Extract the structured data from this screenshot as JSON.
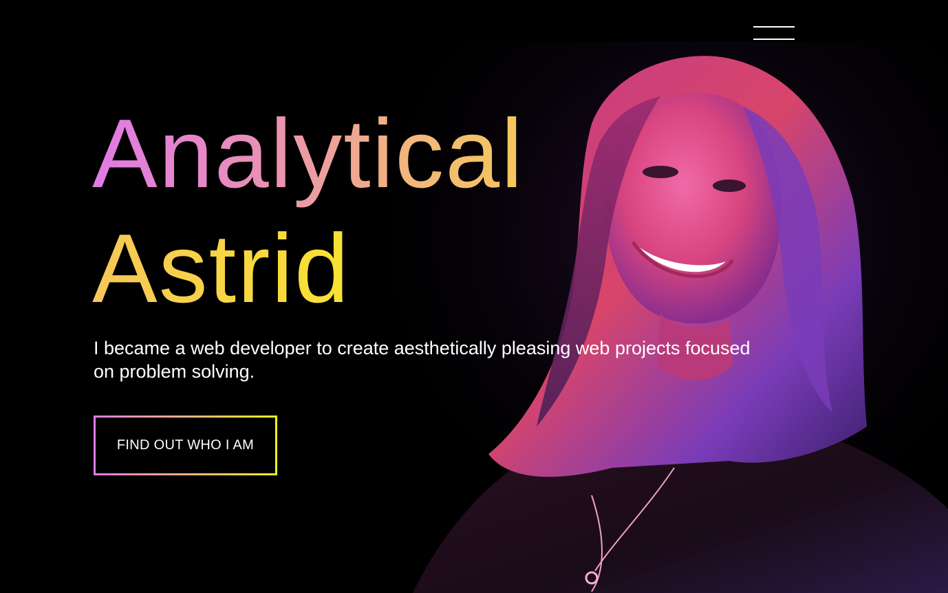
{
  "nav": {
    "menu_icon": "hamburger-menu-icon"
  },
  "hero": {
    "headline_line_1": "Analytical",
    "headline_line_2": "Astrid",
    "tagline": "I became a web developer to create aesthetically pleasing web projects focused on problem solving.",
    "cta_label": "FIND OUT WHO I AM"
  },
  "colors": {
    "background": "#000000",
    "gradient_start": "#e07ae6",
    "gradient_mid": "#f2b879",
    "gradient_end": "#fbf21a",
    "text": "#ffffff"
  }
}
